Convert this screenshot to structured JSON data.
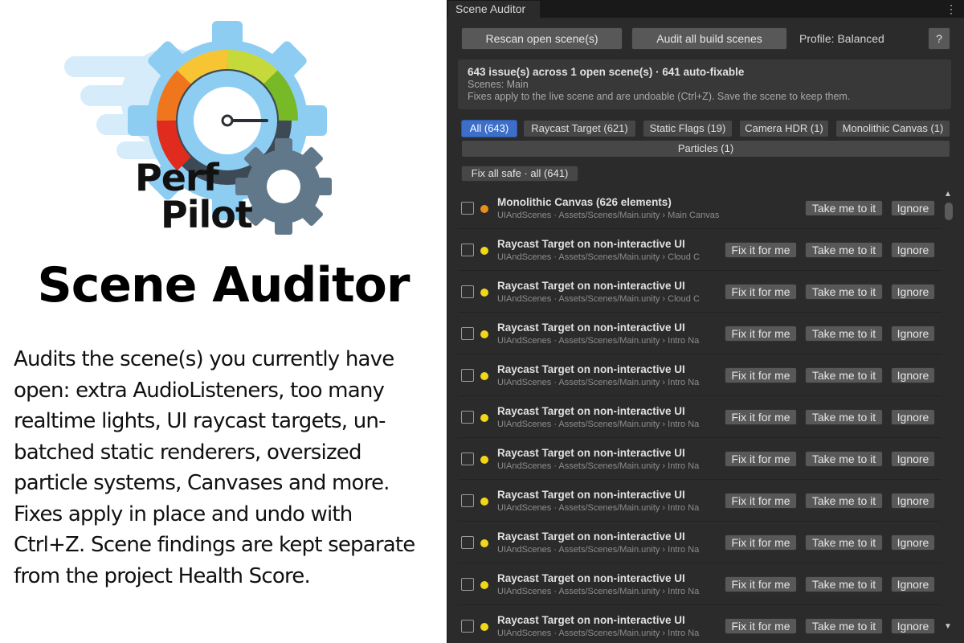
{
  "promo": {
    "logo_words": [
      "Perf",
      "Pilot"
    ],
    "title": "Scene Auditor",
    "description": "Audits the scene(s) you currently have open: extra AudioListeners, too many realtime lights, UI raycast targets, un-batched static renderers, oversized particle systems, Canvases and more. Fixes apply in place and undo with Ctrl+Z. Scene findings are kept separate from the project Health Score."
  },
  "window": {
    "tab_title": "Scene Auditor",
    "menu_glyph": "⋮"
  },
  "toolbar": {
    "rescan_label": "Rescan open scene(s)",
    "audit_label": "Audit all build scenes",
    "profile_label": "Profile: Balanced",
    "help_label": "?"
  },
  "summary": {
    "headline": "643 issue(s) across 1 open scene(s) · 641 auto-fixable",
    "scenes": "Scenes: Main",
    "note": "Fixes apply to the live scene and are undoable (Ctrl+Z). Save the scene to keep them."
  },
  "filters": {
    "all": "All (643)",
    "raycast": "Raycast Target (621)",
    "static": "Static Flags (19)",
    "hdr": "Camera HDR (1)",
    "mono": "Monolithic Canvas (1)",
    "particles": "Particles (1)"
  },
  "fix_all_label": "Fix all safe · all (641)",
  "row_buttons": {
    "fix": "Fix it for me",
    "take": "Take me to it",
    "ignore": "Ignore"
  },
  "issues": [
    {
      "title": "Monolithic Canvas (626 elements)",
      "path": "UIAndScenes · Assets/Scenes/Main.unity  ›  Main Canvas",
      "severity": "orange",
      "fixable": false
    },
    {
      "title": "Raycast Target on non-interactive UI",
      "path": "UIAndScenes · Assets/Scenes/Main.unity  ›  Cloud C",
      "severity": "yellow",
      "fixable": true
    },
    {
      "title": "Raycast Target on non-interactive UI",
      "path": "UIAndScenes · Assets/Scenes/Main.unity  ›  Cloud C",
      "severity": "yellow",
      "fixable": true
    },
    {
      "title": "Raycast Target on non-interactive UI",
      "path": "UIAndScenes · Assets/Scenes/Main.unity  ›  Intro Na",
      "severity": "yellow",
      "fixable": true
    },
    {
      "title": "Raycast Target on non-interactive UI",
      "path": "UIAndScenes · Assets/Scenes/Main.unity  ›  Intro Na",
      "severity": "yellow",
      "fixable": true
    },
    {
      "title": "Raycast Target on non-interactive UI",
      "path": "UIAndScenes · Assets/Scenes/Main.unity  ›  Intro Na",
      "severity": "yellow",
      "fixable": true
    },
    {
      "title": "Raycast Target on non-interactive UI",
      "path": "UIAndScenes · Assets/Scenes/Main.unity  ›  Intro Na",
      "severity": "yellow",
      "fixable": true
    },
    {
      "title": "Raycast Target on non-interactive UI",
      "path": "UIAndScenes · Assets/Scenes/Main.unity  ›  Intro Na",
      "severity": "yellow",
      "fixable": true
    },
    {
      "title": "Raycast Target on non-interactive UI",
      "path": "UIAndScenes · Assets/Scenes/Main.unity  ›  Intro Na",
      "severity": "yellow",
      "fixable": true
    },
    {
      "title": "Raycast Target on non-interactive UI",
      "path": "UIAndScenes · Assets/Scenes/Main.unity  ›  Intro Na",
      "severity": "yellow",
      "fixable": true
    },
    {
      "title": "Raycast Target on non-interactive UI",
      "path": "UIAndScenes · Assets/Scenes/Main.unity  ›  Intro Na",
      "severity": "yellow",
      "fixable": true
    }
  ],
  "colors": {
    "panel_bg": "#2b2b2b",
    "button_bg": "#585858",
    "active_filter": "#3d6ec8",
    "warning_orange": "#e8901c",
    "warning_yellow": "#f2d61a",
    "logo_gauge_red": "#e02b1f",
    "logo_gauge_green": "#78b928",
    "logo_cloud": "#d6ecfa",
    "logo_gear_blue": "#8ecdf2",
    "logo_gear_slate": "#607889"
  }
}
